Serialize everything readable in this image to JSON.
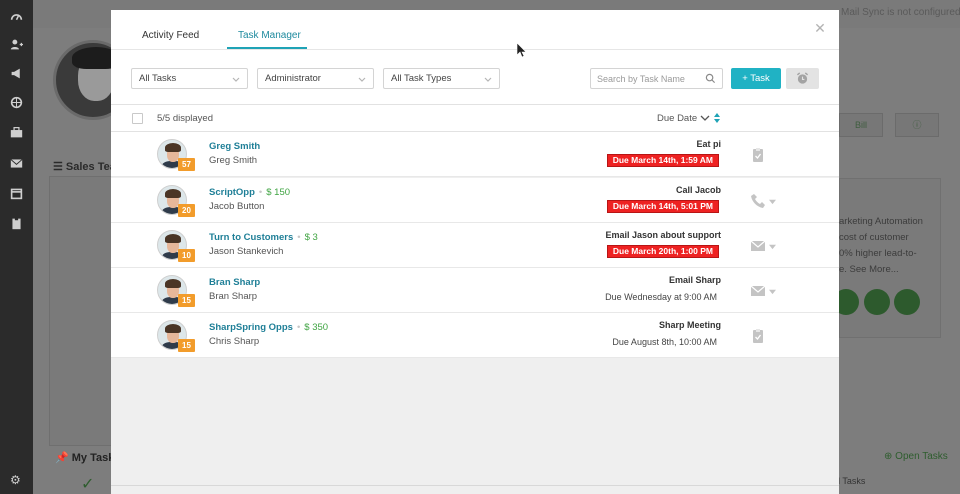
{
  "background": {
    "note": "Mail Sync is not configured",
    "sales_label": "Sales Tea",
    "right_text": [
      "arketing Automation",
      "cost of customer",
      "0% higher lead-to-",
      "e. See More..."
    ],
    "tab_label": "Bill",
    "my_tasks": "My Tasks",
    "open_tasks": "Open Tasks",
    "right_tasks": "al Tasks"
  },
  "tabs": [
    {
      "label": "Activity Feed"
    },
    {
      "label": "Task Manager",
      "active": true
    }
  ],
  "filters": {
    "task_filter": "All Tasks",
    "user_filter": "Administrator",
    "type_filter": "All Task Types",
    "search_placeholder": "Search by Task Name",
    "add_task_label": "+ Task"
  },
  "list_header": {
    "displayed": "5/5 displayed",
    "sort_label": "Due Date"
  },
  "tasks": [
    {
      "name": "Greg Smith",
      "value": "",
      "contact": "Greg Smith",
      "badge": "57",
      "title": "Eat pi",
      "due": "Due March 14th, 1:59 AM",
      "overdue": true,
      "type_icon": "clipboard-icon",
      "has_menu": false
    },
    {
      "name": "ScriptOpp",
      "value": "$ 150",
      "contact": "Jacob Button",
      "badge": "20",
      "title": "Call Jacob",
      "due": "Due March 14th, 5:01 PM",
      "overdue": true,
      "type_icon": "phone-icon",
      "has_menu": true
    },
    {
      "name": "Turn to Customers",
      "value": "$ 3",
      "contact": "Jason Stankevich",
      "badge": "10",
      "title": "Email Jason about support",
      "due": "Due March 20th, 1:00 PM",
      "overdue": true,
      "type_icon": "envelope-icon",
      "has_menu": true
    },
    {
      "name": "Bran Sharp",
      "value": "",
      "contact": "Bran Sharp",
      "badge": "15",
      "title": "Email Sharp",
      "due": "Due Wednesday at 9:00 AM",
      "overdue": false,
      "type_icon": "envelope-icon",
      "has_menu": true
    },
    {
      "name": "SharpSpring Opps",
      "value": "$ 350",
      "contact": "Chris Sharp",
      "badge": "15",
      "title": "Sharp Meeting",
      "due": "Due August 8th, 10:00 AM",
      "overdue": false,
      "type_icon": "clipboard-icon",
      "has_menu": false
    }
  ],
  "colors": {
    "accent": "#20b2c4",
    "link": "#1f7f97",
    "value_green": "#3fa442",
    "overdue_red": "#ee2222",
    "badge_orange": "#f29c2b"
  }
}
